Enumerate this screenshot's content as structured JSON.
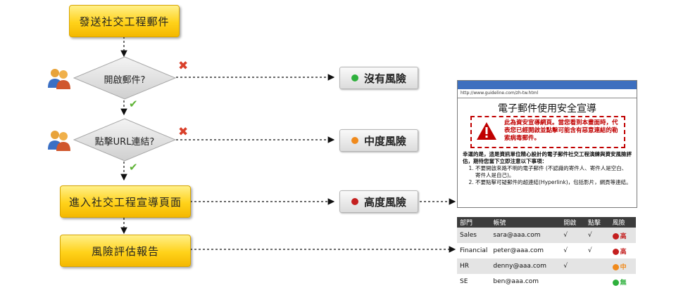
{
  "flow": {
    "send_email": "發送社交工程郵件",
    "q_open": "開啟郵件?",
    "q_click": "點擊URL連結?",
    "enter_page": "進入社交工程宣導頁面",
    "report": "風險評估報告"
  },
  "risk": {
    "none": "沒有風險",
    "medium": "中度風險",
    "high": "高度風險"
  },
  "colors": {
    "none": "#2eb03c",
    "medium": "#f08a1c",
    "high": "#c41f1f"
  },
  "webpage": {
    "url": "http://www.guideline.com/zh-tw.html",
    "title": "電子郵件使用安全宣導",
    "warning": "此為資安宣導網頁。當您看到本畫面時，代表您已經開啟並點擊可能含有惡意連結的勒索病毒郵件。",
    "intro": "幸運的是，這是資訊單位精心設計的電子郵件社交工程演練與資安風險評估，期待您當下立即注意以下事項：",
    "items": [
      "不要開啟來路不明的電子郵件 (不認識的寄件人、寄件人是空白、寄件人是自己)。",
      "不要點擊可疑郵件的超連結(Hyperlink)，包括影片，網頁等連結。"
    ]
  },
  "report_table": {
    "headers": [
      "部門",
      "帳號",
      "開啟",
      "點擊",
      "風險"
    ],
    "rows": [
      {
        "dept": "Sales",
        "account": "sara@aaa.com",
        "open": "√",
        "click": "√",
        "risk": "高",
        "color": "#c41f1f"
      },
      {
        "dept": "Financial",
        "account": "peter@aaa.com",
        "open": "√",
        "click": "√",
        "risk": "高",
        "color": "#c41f1f"
      },
      {
        "dept": "HR",
        "account": "denny@aaa.com",
        "open": "√",
        "click": "",
        "risk": "中",
        "color": "#f08a1c"
      },
      {
        "dept": "SE",
        "account": "ben@aaa.com",
        "open": "",
        "click": "",
        "risk": "無",
        "color": "#2eb03c"
      }
    ]
  }
}
